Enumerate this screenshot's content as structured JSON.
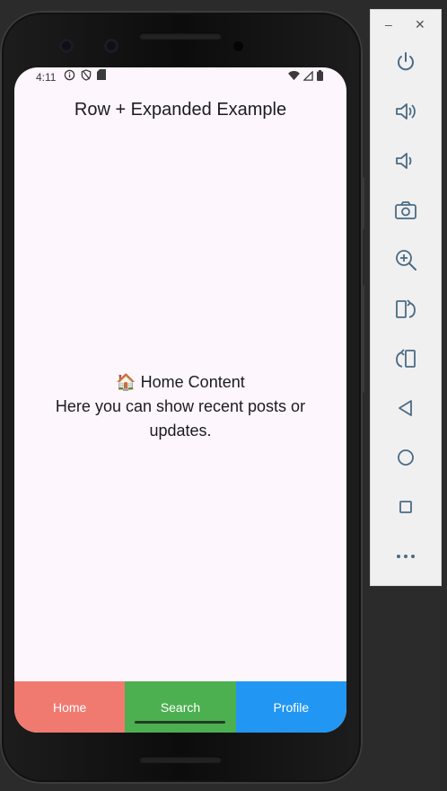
{
  "status_bar": {
    "time": "4:11"
  },
  "app": {
    "title": "Row + Expanded Example",
    "content_line1": "🏠 Home Content",
    "content_line2": "Here you can show recent posts or updates."
  },
  "bottom_nav": {
    "items": [
      {
        "label": "Home",
        "color": "#f07a70"
      },
      {
        "label": "Search",
        "color": "#4caf50",
        "selected": true
      },
      {
        "label": "Profile",
        "color": "#2196f3"
      }
    ]
  },
  "emulator_toolbar": {
    "minimize": "–",
    "close": "✕",
    "buttons": [
      "power-icon",
      "volume-up-icon",
      "volume-down-icon",
      "camera-icon",
      "zoom-in-icon",
      "rotate-left-icon",
      "rotate-right-icon",
      "back-icon",
      "home-icon",
      "overview-icon",
      "more-icon"
    ]
  }
}
